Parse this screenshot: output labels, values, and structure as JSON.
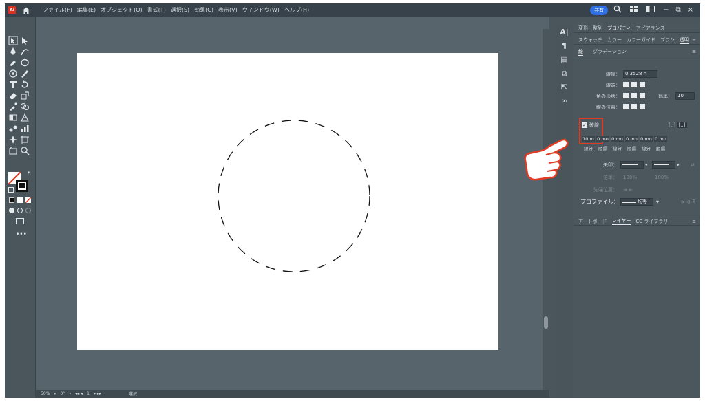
{
  "app": {
    "logo": "Ai"
  },
  "menu": [
    "ファイル(F)",
    "編集(E)",
    "オブジェクト(O)",
    "書式(T)",
    "選択(S)",
    "効果(C)",
    "表示(V)",
    "ウィンドウ(W)",
    "ヘルプ(H)"
  ],
  "header_right": {
    "share_label": "共有",
    "search_icon": "search-icon",
    "layout_icon": "grid-icon",
    "panel_icon": "panel-icon",
    "minimize": "−",
    "restore": "⧉",
    "close": "×"
  },
  "status_bar": {
    "zoom": "50%",
    "angle": "0°",
    "artboard": "1",
    "mode": "選択"
  },
  "panel": {
    "top_tabs": [
      "変形",
      "整列",
      "プロパティ",
      "アピアランス"
    ],
    "second_tabs": [
      "スウォッチ",
      "カラー",
      "カラーガイド",
      "ブラシ",
      "透明"
    ],
    "section_tabs": [
      "線",
      "グラデーション"
    ],
    "stroke": {
      "weight_label": "線幅：",
      "weight_value": "0.3528 n",
      "cap_label": "線端：",
      "corner_label": "角の形状：",
      "limit_label": "比率：",
      "limit_value": "10",
      "align_label": "線の位置："
    },
    "dashed": {
      "checkbox_label": "破線",
      "checked": true,
      "values": [
        "10 m",
        "0 mn",
        "0 mn",
        "0 mn",
        "0 mn",
        "0 mn"
      ],
      "labels": [
        "線分",
        "間隔",
        "線分",
        "間隔",
        "線分",
        "間隔"
      ]
    },
    "arrows_label": "矢印：",
    "scale_label": "倍率：",
    "scale_values": [
      "100%",
      "100%"
    ],
    "align_arrow_label": "先端位置：",
    "profile_label": "プロファイル：",
    "profile_value": "均等",
    "bottom_tabs": [
      "アートボード",
      "レイヤー",
      "CC ライブラリ"
    ]
  },
  "colors": {
    "ui_dark": "#37424a",
    "panel": "#4b565d",
    "highlight_box": "#e23b23",
    "share": "#2f6fe4"
  }
}
